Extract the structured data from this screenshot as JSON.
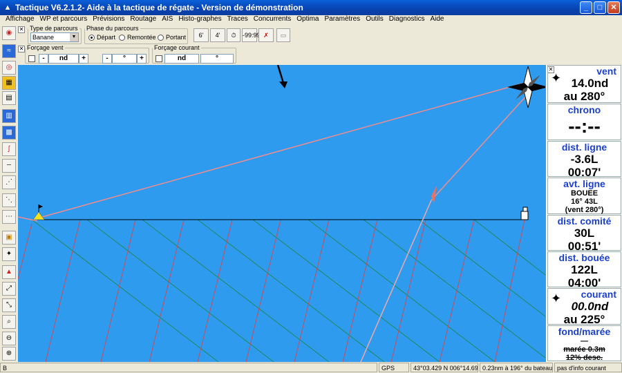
{
  "window": {
    "title": "Tactique V6.2.1.2- Aide à la tactique de régate - Version de démonstration"
  },
  "menu": [
    "Affichage",
    "WP et parcours",
    "Prévisions",
    "Routage",
    "AIS",
    "Histo-graphes",
    "Traces",
    "Concurrents",
    "Optima",
    "Paramètres",
    "Outils",
    "Diagnostics",
    "Aide"
  ],
  "course": {
    "legend": "Type de parcours",
    "selected": "Banane"
  },
  "phase": {
    "legend": "Phase du parcours",
    "options": [
      "Départ",
      "Remontée",
      "Portant"
    ],
    "selected": "Départ"
  },
  "tools": {
    "b1": "6'",
    "b2": "4'",
    "b4": "-99:99"
  },
  "wind_force": {
    "legend": "Forçage vent",
    "minus": "-",
    "plus": "+",
    "speed_unit": "nd",
    "dir_unit": "°"
  },
  "current_force": {
    "legend": "Forçage courant",
    "speed_unit": "nd",
    "dir_unit": "°"
  },
  "panel": {
    "vent": {
      "title": "vent",
      "speed": "14.0nd",
      "dir": "au 280°"
    },
    "chrono": {
      "title": "chrono",
      "value": "--:--"
    },
    "dist_ligne": {
      "title": "dist. ligne",
      "dist": "-3.6L",
      "time": "00:07'"
    },
    "avt_ligne": {
      "title": "avt. ligne",
      "l1": "BOUEE",
      "l2": "16° 43L",
      "l3": "(vent 280°)"
    },
    "dist_comite": {
      "title": "dist. comité",
      "dist": "30L",
      "time": "00:51'"
    },
    "dist_bouee": {
      "title": "dist. bouée",
      "dist": "122L",
      "time": "04:00'"
    },
    "courant": {
      "title": "courant",
      "speed": "00.0nd",
      "dir": "au 225°"
    },
    "fond": {
      "title": "fond/marée",
      "l1": "—",
      "l2": "marée 0.3m",
      "l3": "12% desc."
    }
  },
  "status": {
    "s1": "B",
    "gps": "GPS",
    "pos": "43°03.429 N  006°14.695 E",
    "dist": "0.23nm à 196° du bateau",
    "info": "pas d'info courant"
  },
  "colors": {
    "sea": "#2e9bef",
    "layline_port": "#cc4a5a",
    "layline_stbd": "#1f8a5a",
    "route": "#f08c8c"
  }
}
